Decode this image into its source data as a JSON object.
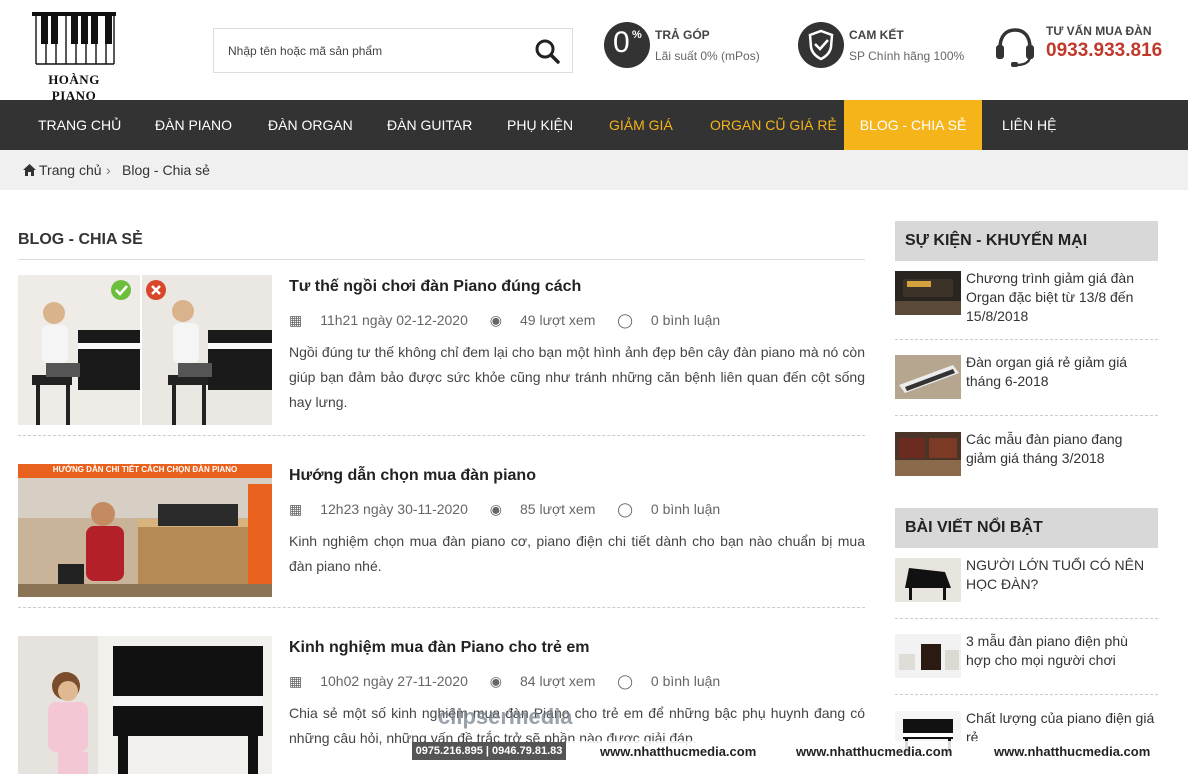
{
  "header": {
    "logo_text": "HOÀNG PIANO",
    "search_placeholder": "Nhập tên hoặc mã sản phẩm",
    "installment": {
      "big": "0",
      "pct": "%",
      "title": "TRẢ GÓP",
      "sub": "Lãi suất 0% (mPos)"
    },
    "commit": {
      "title": "CAM KẾT",
      "sub": "SP Chính hãng 100%"
    },
    "hotline": {
      "title": "TƯ VẤN MUA ĐÀN",
      "phone": "0933.933.816"
    }
  },
  "nav": {
    "items": [
      {
        "label": "TRANG CHỦ"
      },
      {
        "label": "ĐÀN PIANO"
      },
      {
        "label": "ĐÀN ORGAN"
      },
      {
        "label": "ĐÀN GUITAR"
      },
      {
        "label": "PHỤ KIỆN"
      },
      {
        "label": "GIẢM GIÁ"
      },
      {
        "label": "ORGAN CŨ GIÁ RẺ"
      },
      {
        "label": "BLOG - CHIA SẺ"
      },
      {
        "label": "LIÊN HỆ"
      }
    ]
  },
  "breadcrumb": {
    "home": "Trang chủ",
    "current": "Blog - Chia sẻ"
  },
  "main": {
    "title": "BLOG - CHIA SẺ",
    "posts": [
      {
        "title": "Tư thế ngồi chơi đàn Piano đúng cách",
        "date": "11h21 ngày 02-12-2020",
        "views": "49 lượt xem",
        "comments": "0 bình luận",
        "excerpt": "Ngồi đúng tư thế không chỉ đem lại cho bạn một hình ảnh đẹp bên cây đàn piano mà nó còn giúp bạn đảm bảo được sức khỏe cũng như tránh những căn bệnh liên quan đến cột sống hay lưng."
      },
      {
        "title": "Hướng dẫn chọn mua đàn piano",
        "date": "12h23 ngày 30-11-2020",
        "views": "85 lượt xem",
        "comments": "0 bình luận",
        "excerpt": "Kinh nghiệm chọn mua đàn piano cơ, piano điện chi tiết dành cho bạn nào chuẩn bị mua đàn piano nhé.",
        "banner": "HƯỚNG DẪN CHI TIẾT CÁCH CHỌN ĐÀN PIANO"
      },
      {
        "title": "Kinh nghiệm mua đàn Piano cho trẻ em",
        "date": "10h02 ngày 27-11-2020",
        "views": "84 lượt xem",
        "comments": "0 bình luận",
        "excerpt": "Chia sẻ một số kinh nghiệm mua đàn Piano cho trẻ em để những bậc phụ huynh đang có những câu hỏi, những vấn đề trắc trở sẽ phần nào được giải đáp."
      }
    ]
  },
  "sidebar": {
    "events_title": "SỰ KIỆN - KHUYẾN MẠI",
    "events": [
      {
        "title": "Chương trình giảm giá đàn Organ đặc biệt từ 13/8 đến 15/8/2018"
      },
      {
        "title": "Đàn organ giá rẻ giảm giá tháng 6-2018"
      },
      {
        "title": "Các mẫu đàn piano đang giảm giá tháng 3/2018"
      }
    ],
    "featured_title": "BÀI VIẾT NỔI BẬT",
    "featured": [
      {
        "title": "NGƯỜI LỚN TUỔI CÓ NÊN HỌC ĐÀN?"
      },
      {
        "title": "3 mẫu đàn piano điện phù hợp cho mọi người chơi"
      },
      {
        "title": "Chất lượng của piano điện giá rẻ"
      }
    ]
  },
  "watermark": {
    "brand": "clipsermedia",
    "phones": "0975.216.895 | 0946.79.81.83",
    "url": "www.nhatthucmedia.com"
  },
  "colors": {
    "accent": "#f4b41a",
    "nav_bg": "#333333",
    "hotline": "#c0392b"
  }
}
